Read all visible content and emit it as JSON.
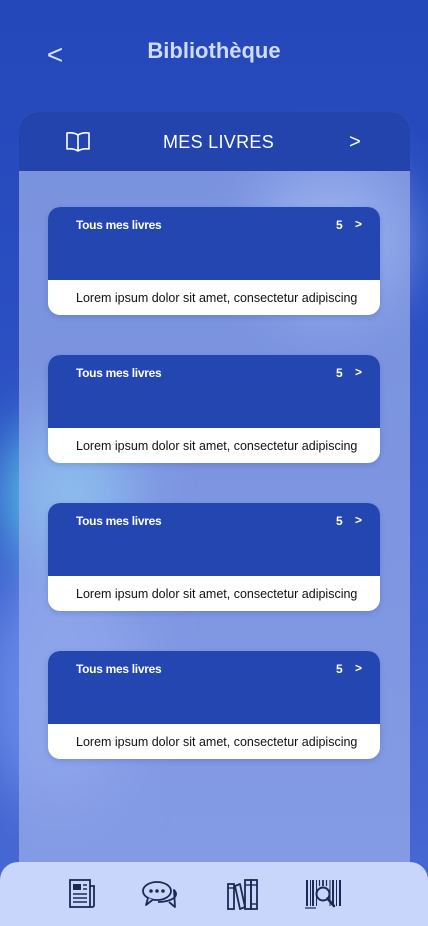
{
  "header": {
    "title": "Bibliothèque",
    "back_glyph": "<"
  },
  "section": {
    "title": "MES LIVRES",
    "icon": "open-book-icon",
    "next_glyph": ">"
  },
  "cards": [
    {
      "title": "Tous mes livres",
      "count": "5",
      "chevron": ">",
      "description": "Lorem ipsum dolor sit amet, consectetur adipiscing"
    },
    {
      "title": "Tous mes livres",
      "count": "5",
      "chevron": ">",
      "description": "Lorem ipsum dolor sit amet, consectetur adipiscing"
    },
    {
      "title": "Tous mes livres",
      "count": "5",
      "chevron": ">",
      "description": "Lorem ipsum dolor sit amet, consectetur adipiscing"
    },
    {
      "title": "Tous mes livres",
      "count": "5",
      "chevron": ">",
      "description": "Lorem ipsum dolor sit amet, consectetur adipiscing"
    }
  ],
  "bottom_nav": {
    "items": [
      {
        "icon": "newspaper-icon"
      },
      {
        "icon": "chat-bubbles-icon"
      },
      {
        "icon": "bookshelf-icon"
      },
      {
        "icon": "barcode-scan-icon"
      }
    ]
  },
  "colors": {
    "primary": "#2346b0",
    "header_text": "#cfdcff",
    "nav_background": "#c9d6fb",
    "card_background": "#ffffff"
  }
}
